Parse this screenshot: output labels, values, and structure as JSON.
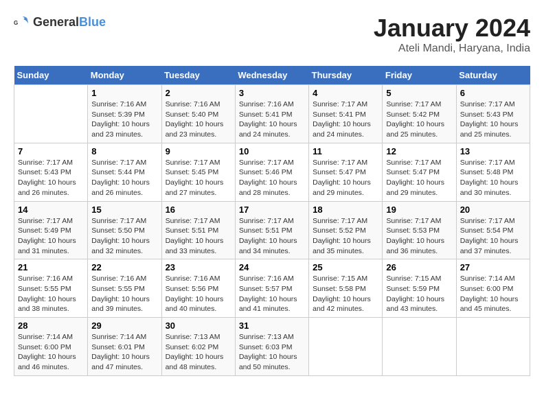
{
  "logo": {
    "general": "General",
    "blue": "Blue"
  },
  "header": {
    "title": "January 2024",
    "subtitle": "Ateli Mandi, Haryana, India"
  },
  "days_of_week": [
    "Sunday",
    "Monday",
    "Tuesday",
    "Wednesday",
    "Thursday",
    "Friday",
    "Saturday"
  ],
  "weeks": [
    [
      {
        "day": "",
        "info": ""
      },
      {
        "day": "1",
        "info": "Sunrise: 7:16 AM\nSunset: 5:39 PM\nDaylight: 10 hours\nand 23 minutes."
      },
      {
        "day": "2",
        "info": "Sunrise: 7:16 AM\nSunset: 5:40 PM\nDaylight: 10 hours\nand 23 minutes."
      },
      {
        "day": "3",
        "info": "Sunrise: 7:16 AM\nSunset: 5:41 PM\nDaylight: 10 hours\nand 24 minutes."
      },
      {
        "day": "4",
        "info": "Sunrise: 7:17 AM\nSunset: 5:41 PM\nDaylight: 10 hours\nand 24 minutes."
      },
      {
        "day": "5",
        "info": "Sunrise: 7:17 AM\nSunset: 5:42 PM\nDaylight: 10 hours\nand 25 minutes."
      },
      {
        "day": "6",
        "info": "Sunrise: 7:17 AM\nSunset: 5:43 PM\nDaylight: 10 hours\nand 25 minutes."
      }
    ],
    [
      {
        "day": "7",
        "info": "Sunrise: 7:17 AM\nSunset: 5:43 PM\nDaylight: 10 hours\nand 26 minutes."
      },
      {
        "day": "8",
        "info": "Sunrise: 7:17 AM\nSunset: 5:44 PM\nDaylight: 10 hours\nand 26 minutes."
      },
      {
        "day": "9",
        "info": "Sunrise: 7:17 AM\nSunset: 5:45 PM\nDaylight: 10 hours\nand 27 minutes."
      },
      {
        "day": "10",
        "info": "Sunrise: 7:17 AM\nSunset: 5:46 PM\nDaylight: 10 hours\nand 28 minutes."
      },
      {
        "day": "11",
        "info": "Sunrise: 7:17 AM\nSunset: 5:47 PM\nDaylight: 10 hours\nand 29 minutes."
      },
      {
        "day": "12",
        "info": "Sunrise: 7:17 AM\nSunset: 5:47 PM\nDaylight: 10 hours\nand 29 minutes."
      },
      {
        "day": "13",
        "info": "Sunrise: 7:17 AM\nSunset: 5:48 PM\nDaylight: 10 hours\nand 30 minutes."
      }
    ],
    [
      {
        "day": "14",
        "info": "Sunrise: 7:17 AM\nSunset: 5:49 PM\nDaylight: 10 hours\nand 31 minutes."
      },
      {
        "day": "15",
        "info": "Sunrise: 7:17 AM\nSunset: 5:50 PM\nDaylight: 10 hours\nand 32 minutes."
      },
      {
        "day": "16",
        "info": "Sunrise: 7:17 AM\nSunset: 5:51 PM\nDaylight: 10 hours\nand 33 minutes."
      },
      {
        "day": "17",
        "info": "Sunrise: 7:17 AM\nSunset: 5:51 PM\nDaylight: 10 hours\nand 34 minutes."
      },
      {
        "day": "18",
        "info": "Sunrise: 7:17 AM\nSunset: 5:52 PM\nDaylight: 10 hours\nand 35 minutes."
      },
      {
        "day": "19",
        "info": "Sunrise: 7:17 AM\nSunset: 5:53 PM\nDaylight: 10 hours\nand 36 minutes."
      },
      {
        "day": "20",
        "info": "Sunrise: 7:17 AM\nSunset: 5:54 PM\nDaylight: 10 hours\nand 37 minutes."
      }
    ],
    [
      {
        "day": "21",
        "info": "Sunrise: 7:16 AM\nSunset: 5:55 PM\nDaylight: 10 hours\nand 38 minutes."
      },
      {
        "day": "22",
        "info": "Sunrise: 7:16 AM\nSunset: 5:55 PM\nDaylight: 10 hours\nand 39 minutes."
      },
      {
        "day": "23",
        "info": "Sunrise: 7:16 AM\nSunset: 5:56 PM\nDaylight: 10 hours\nand 40 minutes."
      },
      {
        "day": "24",
        "info": "Sunrise: 7:16 AM\nSunset: 5:57 PM\nDaylight: 10 hours\nand 41 minutes."
      },
      {
        "day": "25",
        "info": "Sunrise: 7:15 AM\nSunset: 5:58 PM\nDaylight: 10 hours\nand 42 minutes."
      },
      {
        "day": "26",
        "info": "Sunrise: 7:15 AM\nSunset: 5:59 PM\nDaylight: 10 hours\nand 43 minutes."
      },
      {
        "day": "27",
        "info": "Sunrise: 7:14 AM\nSunset: 6:00 PM\nDaylight: 10 hours\nand 45 minutes."
      }
    ],
    [
      {
        "day": "28",
        "info": "Sunrise: 7:14 AM\nSunset: 6:00 PM\nDaylight: 10 hours\nand 46 minutes."
      },
      {
        "day": "29",
        "info": "Sunrise: 7:14 AM\nSunset: 6:01 PM\nDaylight: 10 hours\nand 47 minutes."
      },
      {
        "day": "30",
        "info": "Sunrise: 7:13 AM\nSunset: 6:02 PM\nDaylight: 10 hours\nand 48 minutes."
      },
      {
        "day": "31",
        "info": "Sunrise: 7:13 AM\nSunset: 6:03 PM\nDaylight: 10 hours\nand 50 minutes."
      },
      {
        "day": "",
        "info": ""
      },
      {
        "day": "",
        "info": ""
      },
      {
        "day": "",
        "info": ""
      }
    ]
  ]
}
